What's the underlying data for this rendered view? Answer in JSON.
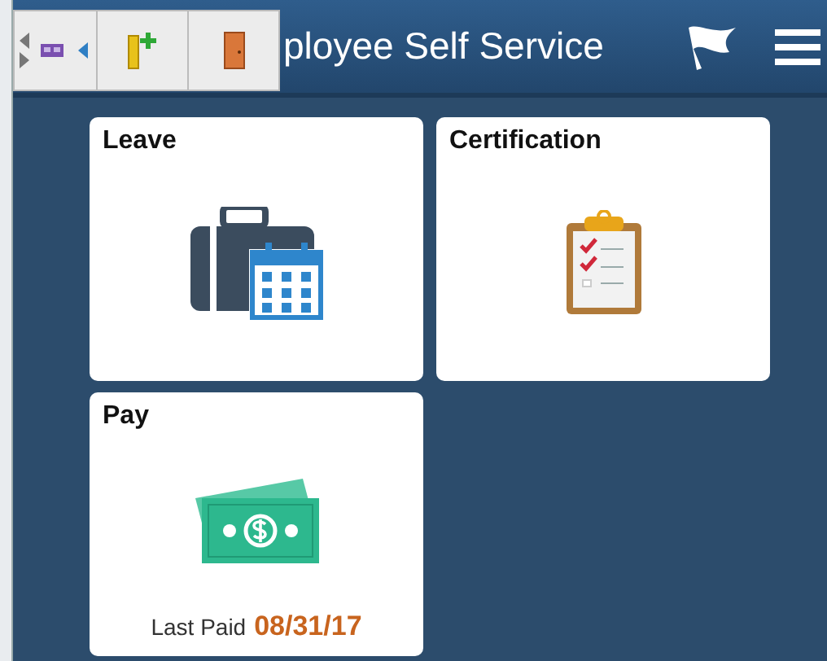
{
  "header": {
    "title": "ployee Self Service"
  },
  "tiles": [
    {
      "title": "Leave",
      "kind": "leave"
    },
    {
      "title": "Certification",
      "kind": "certification"
    },
    {
      "title": "Pay",
      "kind": "pay",
      "footer_label": "Last Paid",
      "footer_value": "08/31/17"
    }
  ]
}
